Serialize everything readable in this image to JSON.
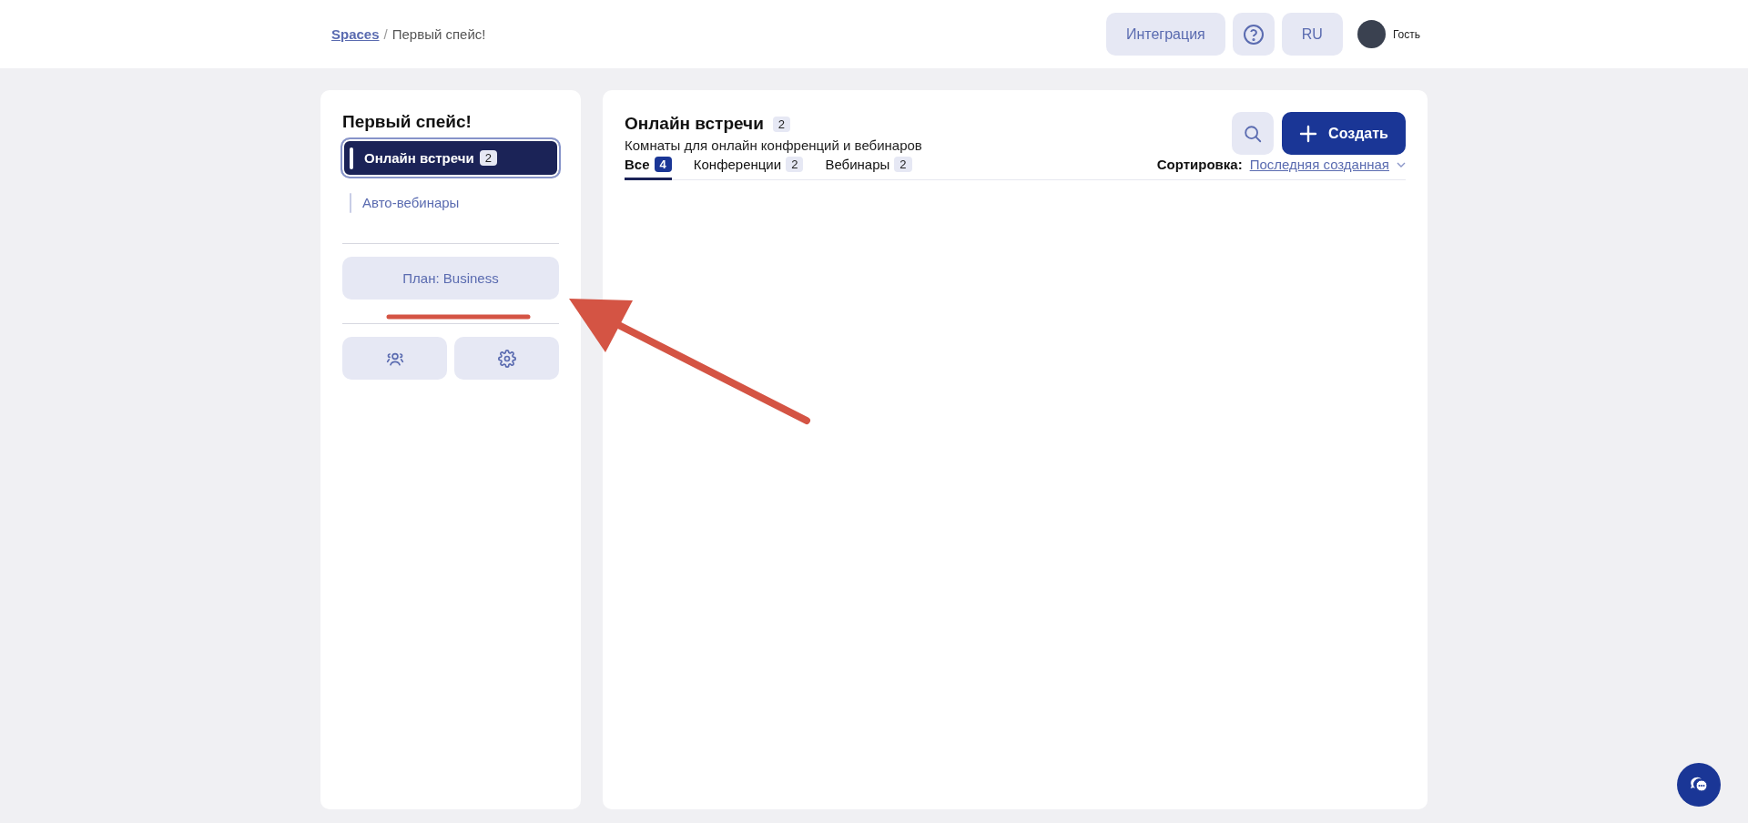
{
  "breadcrumb": {
    "link": "Spaces",
    "separator": "/",
    "current": "Первый спейс!"
  },
  "header_actions": {
    "integration": "Интеграция",
    "language": "RU",
    "user": "Гость"
  },
  "sidebar": {
    "title": "Первый спейс!",
    "items": [
      {
        "label": "Онлайн встречи",
        "count": "2",
        "selected": true
      },
      {
        "label": "Авто-вебинары",
        "selected": false
      }
    ],
    "plan": "План: Business"
  },
  "main": {
    "title": "Онлайн встречи",
    "count": "2",
    "subtitle": "Комнаты для онлайн конфренций и вебинаров",
    "create": "Создать",
    "tabs": [
      {
        "label": "Все",
        "count": "4",
        "selected": true
      },
      {
        "label": "Конференции",
        "count": "2",
        "selected": false
      },
      {
        "label": "Вебинары",
        "count": "2",
        "selected": false
      }
    ],
    "sort": {
      "label": "Сортировка:",
      "value": "Последняя созданная"
    }
  }
}
